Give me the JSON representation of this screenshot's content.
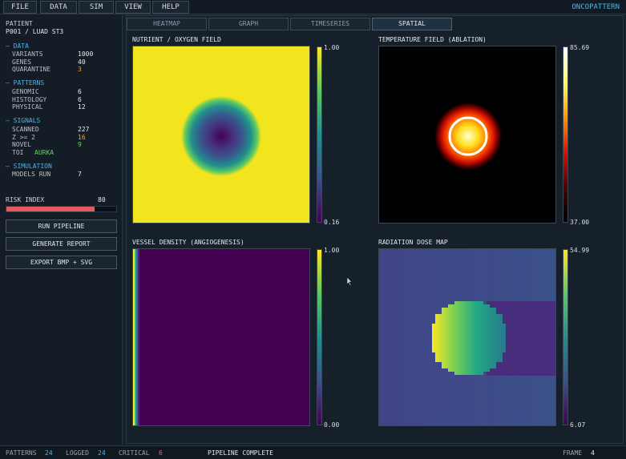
{
  "menu": {
    "items": [
      "FILE",
      "DATA",
      "SIM",
      "VIEW",
      "HELP"
    ],
    "brand": "ONCOPATTERN"
  },
  "patient": {
    "label": "PATIENT",
    "id": "P001 / LUAD ST3"
  },
  "sections": [
    {
      "title": "DATA",
      "rows": [
        {
          "key": "VARIANTS",
          "value": "1000",
          "color": ""
        },
        {
          "key": "GENES",
          "value": "40",
          "color": ""
        },
        {
          "key": "QUARANTINE",
          "value": "3",
          "color": "orange"
        }
      ]
    },
    {
      "title": "PATTERNS",
      "rows": [
        {
          "key": "GENOMIC",
          "value": "6",
          "color": ""
        },
        {
          "key": "HISTOLOGY",
          "value": "6",
          "color": ""
        },
        {
          "key": "PHYSICAL",
          "value": "12",
          "color": ""
        }
      ]
    },
    {
      "title": "SIGNALS",
      "rows": [
        {
          "key": "SCANNED",
          "value": "227",
          "color": ""
        },
        {
          "key": "Z >= 2",
          "value": "16",
          "color": "orange"
        },
        {
          "key": "NOVEL",
          "value": "9",
          "color": "green"
        },
        {
          "key": "TOI",
          "value": "AURKA",
          "color": "green"
        }
      ]
    },
    {
      "title": "SIMULATION",
      "rows": [
        {
          "key": "MODELS RUN",
          "value": "7",
          "color": ""
        }
      ]
    }
  ],
  "risk": {
    "label": "RISK INDEX",
    "value": "80",
    "fraction": 0.8
  },
  "actions": [
    "RUN PIPELINE",
    "GENERATE REPORT",
    "EXPORT BMP + SVG"
  ],
  "tabs": [
    {
      "label": "HEATMAP",
      "active": false
    },
    {
      "label": "GRAPH",
      "active": false
    },
    {
      "label": "TIMESERIES",
      "active": false
    },
    {
      "label": "SPATIAL",
      "active": true
    }
  ],
  "panels": [
    {
      "title": "NUTRIENT / OXYGEN FIELD",
      "cmap": "viridis",
      "max": "1.00",
      "min": "0.16"
    },
    {
      "title": "TEMPERATURE FIELD (ABLATION)",
      "cmap": "hot",
      "max": "85.69",
      "min": "37.00"
    },
    {
      "title": "VESSEL DENSITY (ANGIOGENESIS)",
      "cmap": "viridis",
      "max": "1.00",
      "min": "0.00"
    },
    {
      "title": "RADIATION DOSE MAP",
      "cmap": "viridis",
      "max": "54.99",
      "min": "6.07"
    }
  ],
  "status": {
    "patterns_label": "PATTERNS",
    "patterns": "24",
    "logged_label": "LOGGED",
    "logged": "24",
    "critical_label": "CRITICAL",
    "critical": "6",
    "message": "PIPELINE COMPLETE",
    "frame_label": "FRAME",
    "frame": "4"
  },
  "colors": {
    "accent": "#4fb3e5",
    "warn": "#f0a23a",
    "ok": "#5fd45f",
    "danger": "#e55a5f"
  }
}
